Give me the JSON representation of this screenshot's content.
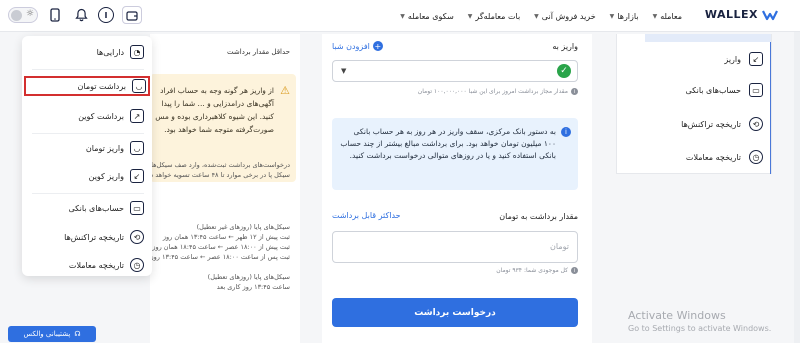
{
  "brand": {
    "name": "WALLEX"
  },
  "nav": [
    {
      "label": "معامله",
      "has_caret": true
    },
    {
      "label": "بازارها",
      "has_caret": true
    },
    {
      "label": "خرید فروش آنی",
      "has_caret": true
    },
    {
      "label": "بات معامله‌گر",
      "has_caret": true
    },
    {
      "label": "سکوی معامله",
      "has_caret": true
    }
  ],
  "top_icons": {
    "user_initial": "I"
  },
  "right_sidebar": {
    "items": [
      {
        "label": "واریز",
        "icon": "deposit-icon"
      },
      {
        "label": "حساب‌های بانکی",
        "icon": "bank-card-icon"
      },
      {
        "label": "تاریخچه تراکنش‌ها",
        "icon": "transactions-history-icon"
      },
      {
        "label": "تاریخچه معاملات",
        "icon": "trades-history-icon"
      }
    ]
  },
  "main": {
    "deposit_label": "واریز به",
    "add_card": "افزودن شبا",
    "daily_limit_hint": "مقدار مجاز برداشت امروز برای این شبا ۱۰۰,۰۰۰,۰۰۰ تومان",
    "info_text": "به دستور بانک مرکزی، سقف واریز در هر روز به هر حساب بانکی ۱۰۰ میلیون تومان خواهد بود. برای برداشت مبالغ بیشتر از چند حساب بانکی استفاده کنید و یا در روزهای متوالی درخواست برداشت کنید.",
    "amount_label": "مقدار برداشت به تومان",
    "max_withdraw": "حداکثر قابل برداشت",
    "amount_placeholder": "تومان",
    "balance_hint": "کل موجودی شما: ۹۳۴ تومان",
    "submit": "درخواست برداشت"
  },
  "left_panel": {
    "title": "حداقل مقدار برداشت",
    "warning_lines": [
      "از واریز هر گونه وجه به حساب افراد",
      "آگهی‌های درامدزایی و ... شما را پیدا",
      "کنید. این شیوه کلاهبرداری بوده و مس",
      "صورت‌گرفته متوجه شما خواهد بود."
    ],
    "process_lines": [
      "درخواست‌های برداشت ثبت‌شده، وارد صف سیکل‌های",
      "سیکل پا در برخی موارد تا ۴۸ ساعت تسویه خواهد ش"
    ],
    "paya_title": "سیکل‌های پایا (روزهای غیر تعطیل)",
    "paya_lines": [
      "ثبت پیش از ۱۲ ظهر ← ساعت ۱۳:۴۵ همان روز",
      "ثبت پیش از ۱۸:۰۰ عصر ← ساعت ۱۸:۴۵ همان روز",
      "ثبت پس از ساعت ۱۸:۰۰ عصر ← ساعت ۱۳:۴۵ روز"
    ],
    "paya_holiday_title": "سیکل‌های پایا (روزهای تعطیل)",
    "paya_holiday_lines": [
      "ساعت ۱۳:۴۵ روز کاری بعد"
    ]
  },
  "dropdown": {
    "items": [
      {
        "label": "دارایی‌ها",
        "icon": "assets-icon",
        "active": false
      },
      {
        "label": "برداشت تومان",
        "icon": "withdraw-toman-icon",
        "active": true
      },
      {
        "label": "برداشت کوین",
        "icon": "withdraw-coin-icon",
        "active": false
      },
      {
        "label": "واریز تومان",
        "icon": "deposit-toman-icon",
        "active": false
      },
      {
        "label": "واریز کوین",
        "icon": "deposit-coin-icon",
        "active": false
      },
      {
        "label": "حساب‌های بانکی",
        "icon": "bank-accounts-icon",
        "active": false
      },
      {
        "label": "تاریخچه تراکنش‌ها",
        "icon": "transactions-history-icon",
        "active": false
      },
      {
        "label": "تاریخچه معاملات",
        "icon": "trades-history-icon",
        "active": false
      }
    ]
  },
  "support": {
    "label": "پشتیبانی والکس"
  },
  "watermark": {
    "line1": "Activate Windows",
    "line2": "Go to Settings to activate Windows."
  },
  "colors": {
    "accent": "#2f6fe0",
    "warning_bg": "#fdf3dc",
    "info_bg": "#e8f2fd",
    "highlight": "#d32f2f"
  }
}
